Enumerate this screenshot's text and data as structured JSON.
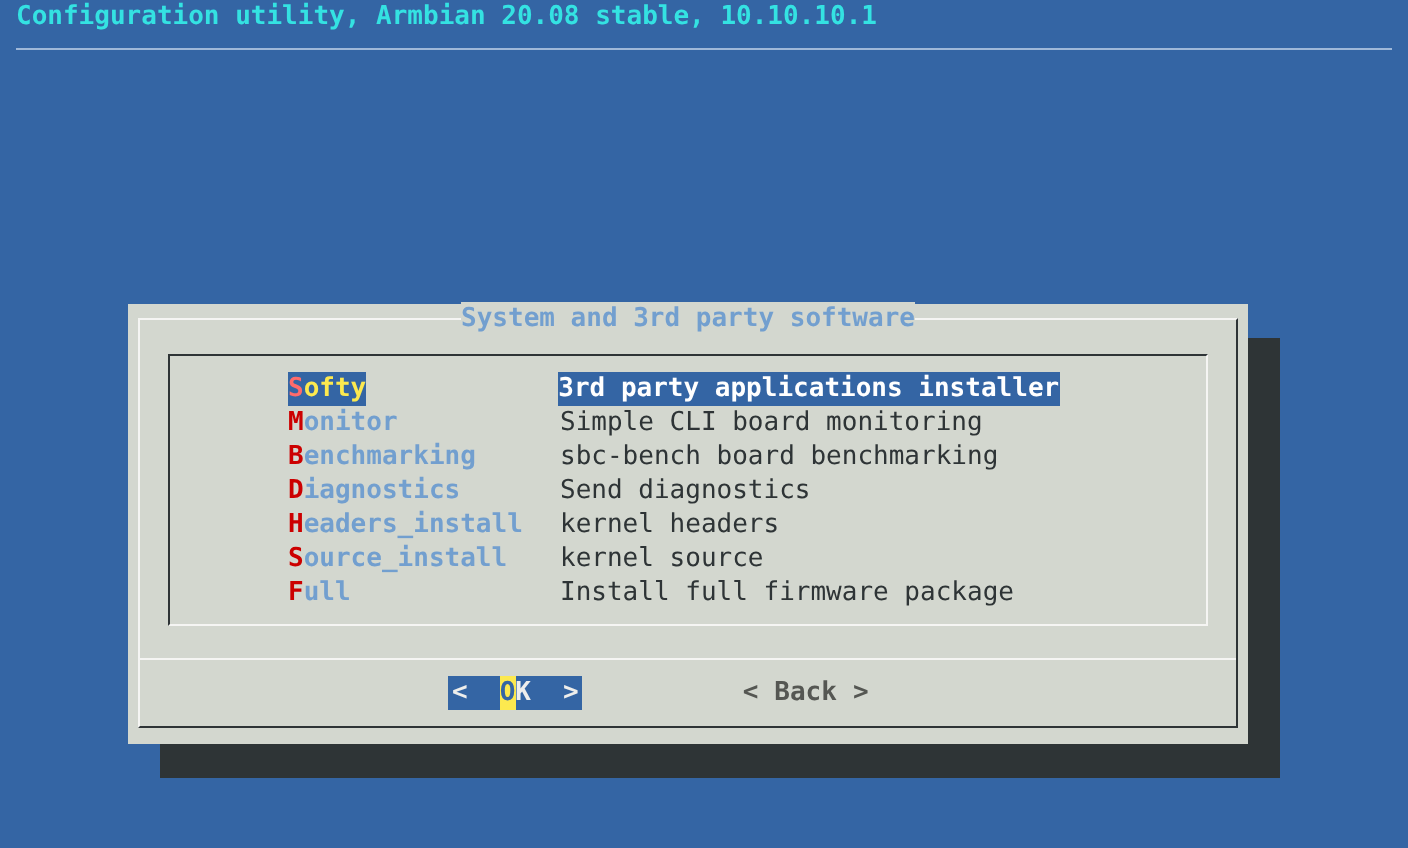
{
  "header": {
    "title": "Configuration utility, Armbian 20.08 stable, 10.10.10.1"
  },
  "dialog": {
    "title": "System and 3rd party software",
    "items": [
      {
        "tag": "Softy",
        "description": "3rd party applications installer",
        "selected": true
      },
      {
        "tag": "Monitor",
        "description": "Simple CLI board monitoring",
        "selected": false
      },
      {
        "tag": "Benchmarking",
        "description": "sbc-bench board benchmarking",
        "selected": false
      },
      {
        "tag": "Diagnostics",
        "description": "Send diagnostics",
        "selected": false
      },
      {
        "tag": "Headers_install",
        "description": "kernel headers",
        "selected": false
      },
      {
        "tag": "Source_install",
        "description": "kernel source",
        "selected": false
      },
      {
        "tag": "Full",
        "description": "Install full firmware package",
        "selected": false
      }
    ],
    "buttons": [
      {
        "open": "<",
        "label": "OK",
        "close": ">",
        "selected": true
      },
      {
        "open": "<",
        "label": "Back",
        "close": ">",
        "selected": false
      }
    ]
  }
}
